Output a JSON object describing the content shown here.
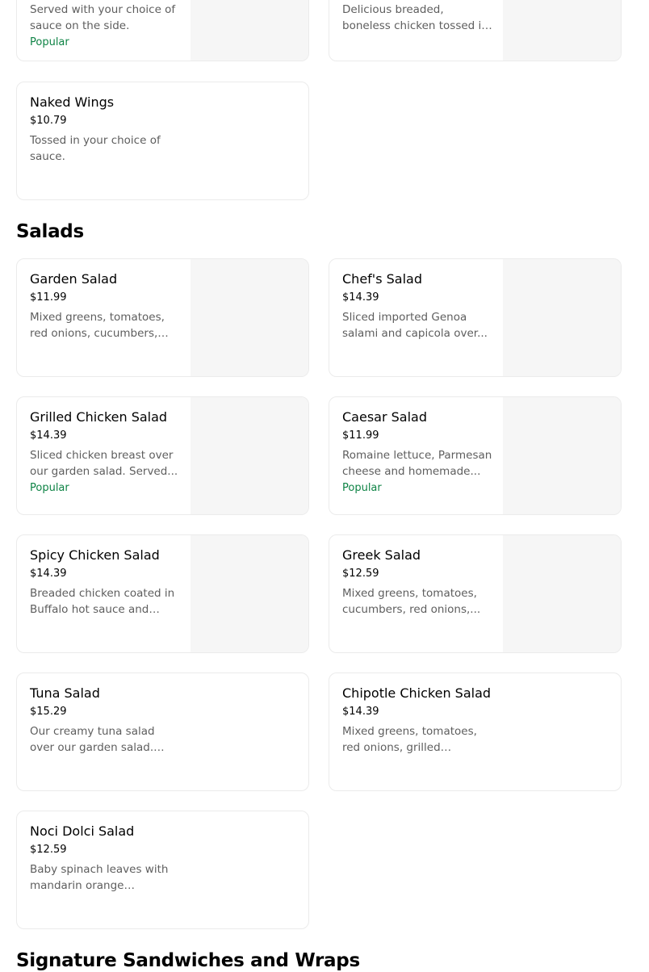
{
  "top_cards": [
    {
      "desc": "Served with your choice of sauce on the side.",
      "badge": "Popular"
    },
    {
      "desc": "Delicious breaded, boneless chicken tossed in your..."
    }
  ],
  "wings": {
    "name": "Naked Wings",
    "price": "$10.79",
    "desc": "Tossed in your choice of sauce."
  },
  "salads": {
    "title": "Salads",
    "items": [
      {
        "name": "Garden Salad",
        "price": "$11.99",
        "desc": "Mixed greens, tomatoes, red onions, cucumbers, green..."
      },
      {
        "name": "Chef's Salad",
        "price": "$14.39",
        "desc": "Sliced imported Genoa salami and capicola over..."
      },
      {
        "name": "Grilled Chicken Salad",
        "price": "$14.39",
        "desc": "Sliced chicken breast over our garden salad. Served...",
        "badge": "Popular"
      },
      {
        "name": "Caesar Salad",
        "price": "$11.99",
        "desc": "Romaine lettuce, Parmesan cheese and homemade...",
        "badge": "Popular"
      },
      {
        "name": "Spicy Chicken Salad",
        "price": "$14.39",
        "desc": "Breaded chicken coated in Buffalo hot sauce and ranc..."
      },
      {
        "name": "Greek Salad",
        "price": "$12.59",
        "desc": "Mixed greens, tomatoes, cucumbers, red onions,..."
      },
      {
        "name": "Tuna Salad",
        "price": "$15.29",
        "desc": "Our creamy tuna salad over our garden salad. Served..."
      },
      {
        "name": "Chipotle Chicken Salad",
        "price": "$14.39",
        "desc": "Mixed greens, tomatoes, red onions, grilled chicken,..."
      },
      {
        "name": "Noci Dolci Salad",
        "price": "$12.59",
        "desc": "Baby spinach leaves with mandarin orange segment..."
      }
    ]
  },
  "sandwiches": {
    "title": "Signature Sandwiches and Wraps"
  },
  "colors": {
    "popular": "#0e8345",
    "description": "#5e5e5e",
    "card_border": "#ebebeb",
    "image_placeholder": "#f6f6f6"
  }
}
